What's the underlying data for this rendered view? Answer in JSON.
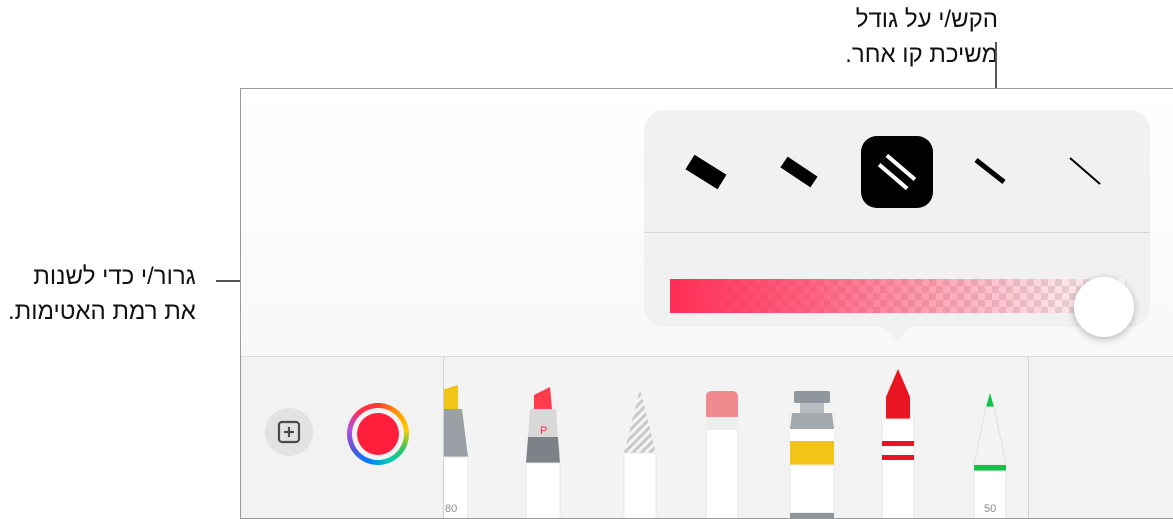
{
  "callouts": {
    "top": {
      "line1": "הקש/י על גודל",
      "line2": "משיכת קו אחר."
    },
    "left": {
      "line1": "גרור/י כדי לשנות",
      "line2": "את רמת האטימות."
    }
  },
  "popover": {
    "line_widths": [
      {
        "name": "width-extra-thick",
        "selected": false
      },
      {
        "name": "width-thick",
        "selected": false
      },
      {
        "name": "width-medium",
        "selected": true
      },
      {
        "name": "width-thin",
        "selected": false
      },
      {
        "name": "width-extra-thin",
        "selected": false
      }
    ],
    "opacity": {
      "value": 1.0,
      "color": "#ff2d55"
    }
  },
  "toolbar": {
    "add_icon": "plus-square-icon",
    "current_color": "#ff1f3d",
    "tools": [
      {
        "name": "marker",
        "number": "80",
        "color": "#f2c418"
      },
      {
        "name": "pen",
        "label": "P",
        "color": "#ff3b4e"
      },
      {
        "name": "pencil",
        "color": "#b0b0b0"
      },
      {
        "name": "eraser",
        "color": "#f08a8f"
      },
      {
        "name": "paint-tube",
        "color": "#f2c418"
      },
      {
        "name": "crayon",
        "color": "#e8141f"
      },
      {
        "name": "fine-pen",
        "number": "50",
        "color": "#13c34a"
      }
    ]
  }
}
